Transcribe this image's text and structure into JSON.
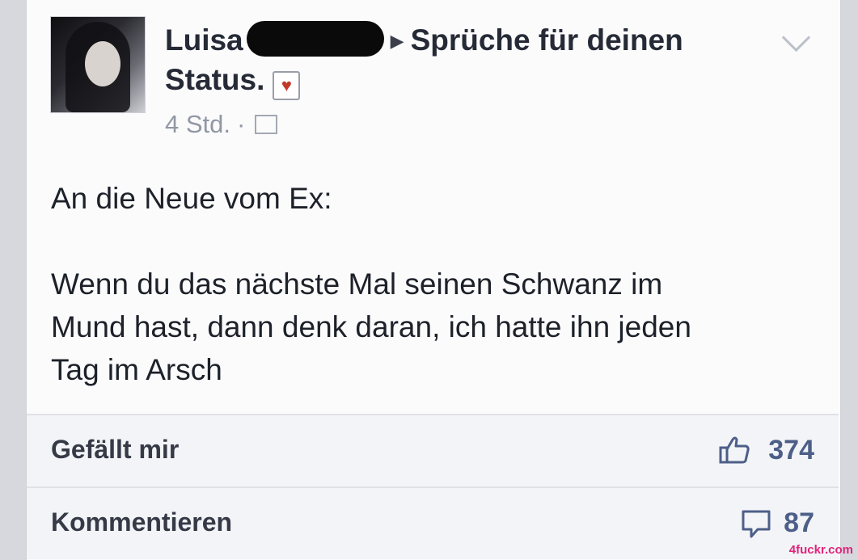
{
  "post": {
    "author": "Luisa",
    "page_name": "Sprüche für deinen",
    "page_name_line2": "Status.",
    "heart_icon": "heart-icon",
    "time": "4 Std.",
    "separator": "·",
    "audience_icon": "friends-icon",
    "text_line1": "An die Neue vom Ex:",
    "text_line2": "Wenn du das nächste Mal seinen Schwanz im",
    "text_line3": "Mund hast, dann denk daran, ich hatte ihn jeden",
    "text_line4": "Tag im Arsch"
  },
  "actions": {
    "like_label": "Gefällt mir",
    "like_count": "374",
    "comment_label": "Kommentieren",
    "comment_count": "87"
  },
  "watermark": "4fuckr.com",
  "colors": {
    "accent": "#4d5f88",
    "text": "#1d2129",
    "meta": "#9197a3"
  }
}
